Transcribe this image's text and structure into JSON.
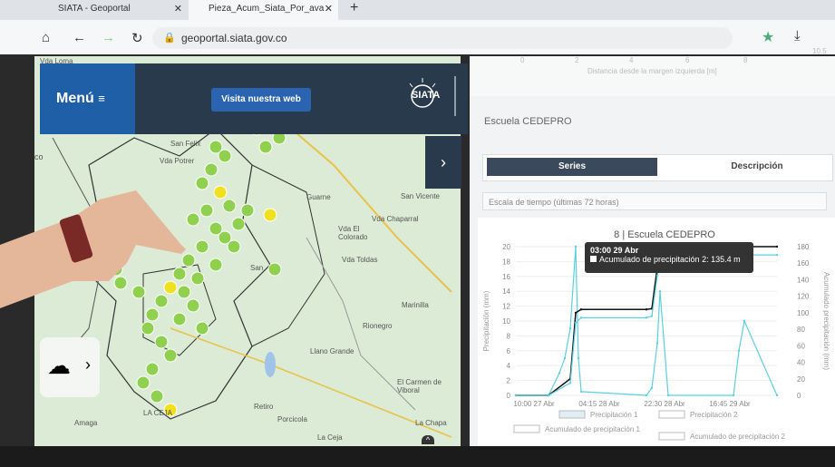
{
  "browser": {
    "tabs": [
      {
        "title": "SIATA - Geoportal",
        "active": false
      },
      {
        "title": "Pieza_Acum_Siata_Por_ava",
        "active": true
      }
    ],
    "new_tab": "+",
    "url": "geoportal.siata.gov.co"
  },
  "header": {
    "menu_label": "Menú",
    "visit_label": "Visita nuestra web",
    "logo_text": "SIATA"
  },
  "map": {
    "places": [
      "Vda Loma",
      "San Felix",
      "Vda Potrer",
      "Guarne",
      "San Vicente",
      "Vda El Colorado",
      "Vda Chaparral",
      "Vda Toldas",
      "Marinilla",
      "Rionegro",
      "Llano Grande",
      "El Carmen de Viboral",
      "Retiro",
      "Porcicola",
      "La Chapa",
      "Amaga",
      "LA CEJA",
      "La Ceja",
      "San"
    ],
    "left_edge_label": "co"
  },
  "panel": {
    "top_axis": [
      "0",
      "2",
      "4",
      "6",
      "8",
      "10.5"
    ],
    "top_axis_label": "Distancia desde la margen izquierda [m]",
    "station_title": "Escuela CEDEPRO",
    "tab_series": "Series",
    "tab_description": "Descripción",
    "time_scale": "Escala de tiempo (últimas 72 horas)"
  },
  "chart_data": {
    "type": "line",
    "title": "8 | Escuela CEDEPRO",
    "ylabel": "Precipitación (mm)",
    "y2label": "Acumulado precipitación (mm)",
    "ylim": [
      0,
      20
    ],
    "y2lim": [
      0,
      180
    ],
    "y_ticks": [
      "0",
      "2",
      "4",
      "6",
      "8",
      "10",
      "12",
      "14",
      "16",
      "18",
      "20"
    ],
    "y2_ticks": [
      "0",
      "20",
      "40",
      "60",
      "80",
      "100",
      "120",
      "140",
      "160",
      "180"
    ],
    "x_ticks": [
      "10:00 27 Abr",
      "04:15 28 Abr",
      "22:30 28 Abr",
      "16:45 29 Abr"
    ],
    "tooltip": {
      "time": "03:00 29 Abr",
      "label": "Acumulado de precipitación 2: 135.4 m"
    },
    "legend": [
      "Precipitación 1",
      "Precipitación 2",
      "Acumulado de precipitación 1",
      "Acumulado de precipitación 2"
    ],
    "series": [
      {
        "name": "Precipitación 1",
        "color": "#5bd0e0",
        "x": [
          0,
          6,
          8,
          9,
          10,
          11,
          11.5,
          12,
          24,
          25,
          26,
          26.5,
          28,
          40,
          41,
          42,
          48
        ],
        "values": [
          0,
          0,
          3,
          5,
          9,
          20,
          5,
          0.5,
          0,
          1,
          7,
          14,
          0,
          0,
          6,
          10,
          0
        ]
      },
      {
        "name": "Acumulado de precipitación 2",
        "color": "#111111",
        "x": [
          0,
          6,
          10,
          11,
          12,
          24,
          25,
          26,
          27,
          48
        ],
        "values": [
          0,
          0,
          20,
          100,
          104,
          104,
          105,
          155,
          180,
          180
        ]
      },
      {
        "name": "Acumulado de precipitación 1",
        "color": "#5bd0e0",
        "x": [
          0,
          6,
          10,
          11,
          12,
          24,
          25,
          26,
          27,
          48
        ],
        "values": [
          0,
          0,
          15,
          88,
          94,
          94,
          96,
          145,
          170,
          170
        ]
      }
    ]
  },
  "colors": {
    "menu_blue": "#1f5fa8",
    "panel_dark": "#293a4d",
    "dot_green": "#8fd14f",
    "dot_yellow": "#f0e020",
    "cyan": "#5bd0e0"
  }
}
